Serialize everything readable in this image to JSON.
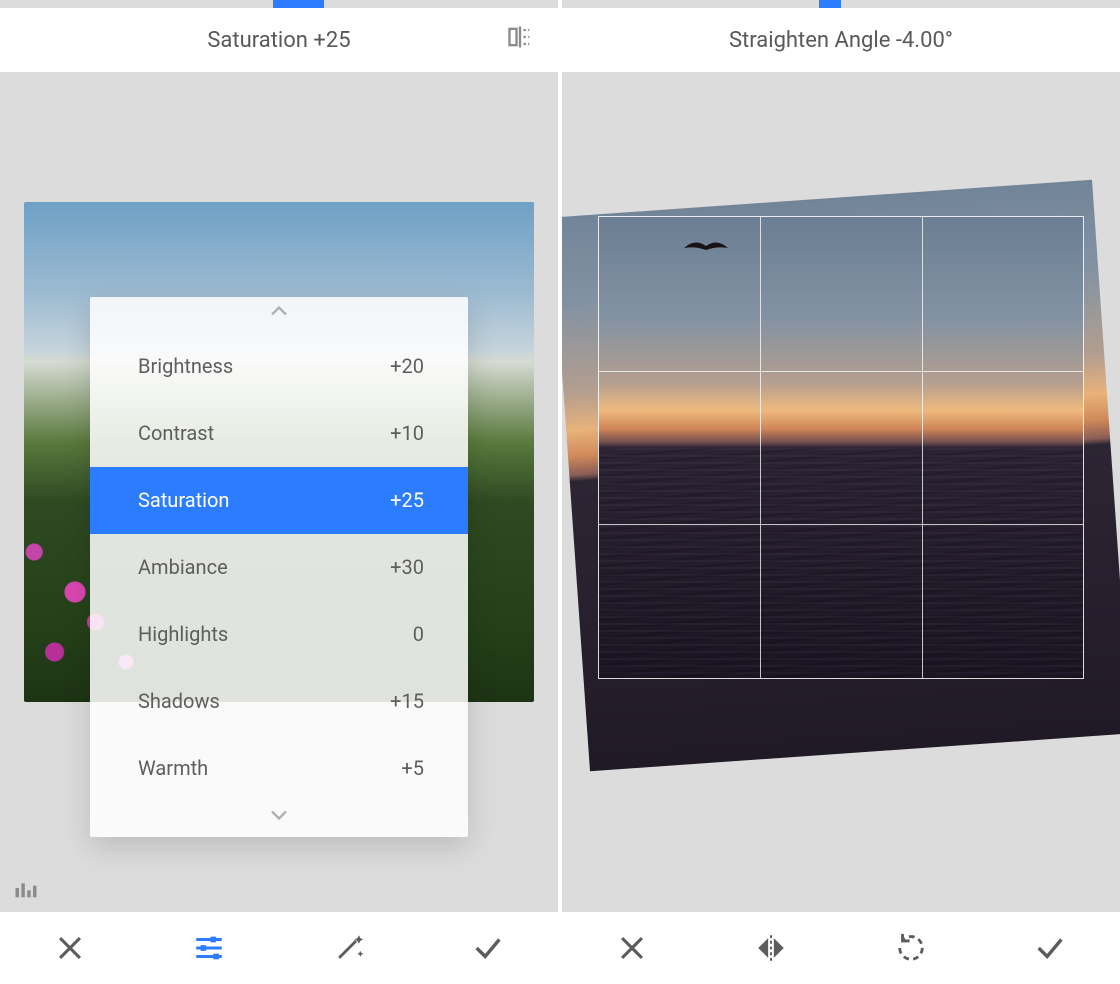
{
  "left": {
    "slider": {
      "left_pct": 49,
      "width_pct": 9
    },
    "header_title": "Saturation +25",
    "adjustments": [
      {
        "label": "Brightness",
        "value": "+20",
        "selected": false
      },
      {
        "label": "Contrast",
        "value": "+10",
        "selected": false
      },
      {
        "label": "Saturation",
        "value": "+25",
        "selected": true
      },
      {
        "label": "Ambiance",
        "value": "+30",
        "selected": false
      },
      {
        "label": "Highlights",
        "value": "0",
        "selected": false
      },
      {
        "label": "Shadows",
        "value": "+15",
        "selected": false
      },
      {
        "label": "Warmth",
        "value": "+5",
        "selected": false
      }
    ],
    "toolbar": {
      "cancel": "close-icon",
      "tune": "tune-icon",
      "magic": "magic-wand-icon",
      "confirm": "check-icon",
      "active": "tune"
    }
  },
  "right": {
    "slider": {
      "left_pct": 46,
      "width_pct": 4
    },
    "header_title": "Straighten Angle -4.00°",
    "angle_deg": -4.0,
    "toolbar": {
      "cancel": "close-icon",
      "flip": "flip-horizontal-icon",
      "rotate": "rotate-ccw-icon",
      "confirm": "check-icon",
      "active": null
    }
  },
  "colors": {
    "accent": "#2b7cff",
    "bg": "#dcdcdc",
    "text": "#595959"
  }
}
